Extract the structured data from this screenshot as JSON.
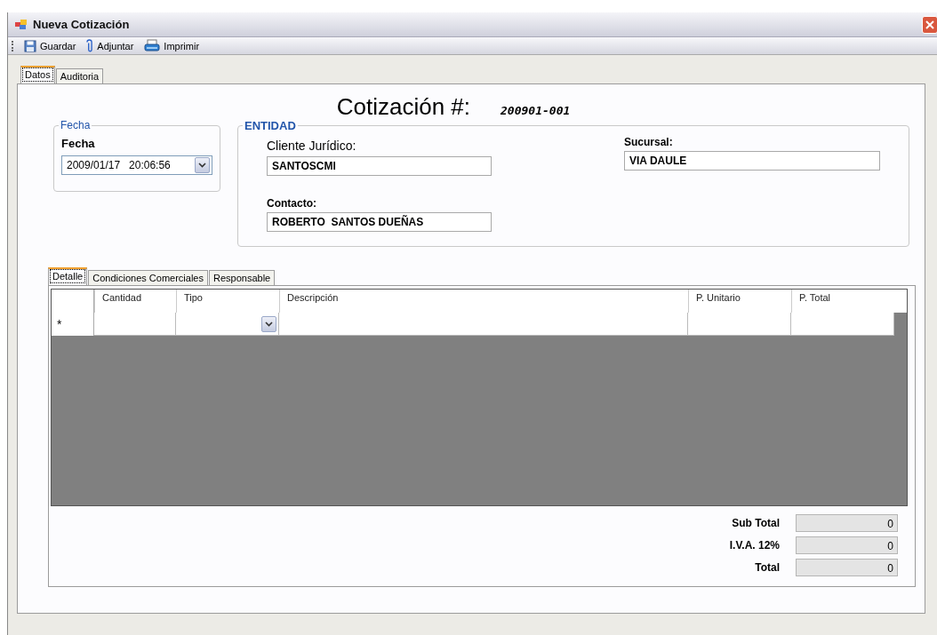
{
  "window": {
    "title": "Nueva Cotización"
  },
  "toolbar": [
    {
      "kind": "save",
      "label": "Guardar"
    },
    {
      "kind": "attach",
      "label": "Adjuntar"
    },
    {
      "kind": "print",
      "label": "Imprimir"
    }
  ],
  "tabs": [
    {
      "label": "Datos",
      "selected": true
    },
    {
      "label": "Auditoria",
      "selected": false
    }
  ],
  "quote": {
    "label": "Cotización #:",
    "number": "200901-001"
  },
  "fecha_group": {
    "title": "Fecha",
    "label": "Fecha",
    "value": "2009/01/17   20:06:56"
  },
  "entidad": {
    "title": "ENTIDAD",
    "fields": [
      {
        "label": "Cliente Jurídico:",
        "value": "SANTOSCMI"
      },
      {
        "label": "Sucursal:",
        "value": "VIA DAULE"
      },
      {
        "label": "Contacto:",
        "value": "ROBERTO  SANTOS DUEÑAS"
      }
    ]
  },
  "detail_tabs": [
    {
      "label": "Detalle",
      "selected": true
    },
    {
      "label": "Condiciones Comerciales",
      "selected": false
    },
    {
      "label": "Responsable",
      "selected": false
    }
  ],
  "table": {
    "columns": [
      {
        "label": "Cantidad",
        "kind": "text"
      },
      {
        "label": "Tipo",
        "kind": "combo"
      },
      {
        "label": "Descripción",
        "kind": "text"
      },
      {
        "label": "P. Unitario",
        "kind": "text"
      },
      {
        "label": "P. Total",
        "kind": "text"
      }
    ],
    "new_row_marker": "*"
  },
  "totals": [
    {
      "label": "Sub Total",
      "value": "0"
    },
    {
      "label": "I.V.A. 12%",
      "value": "0"
    },
    {
      "label": "Total",
      "value": "0"
    }
  ]
}
